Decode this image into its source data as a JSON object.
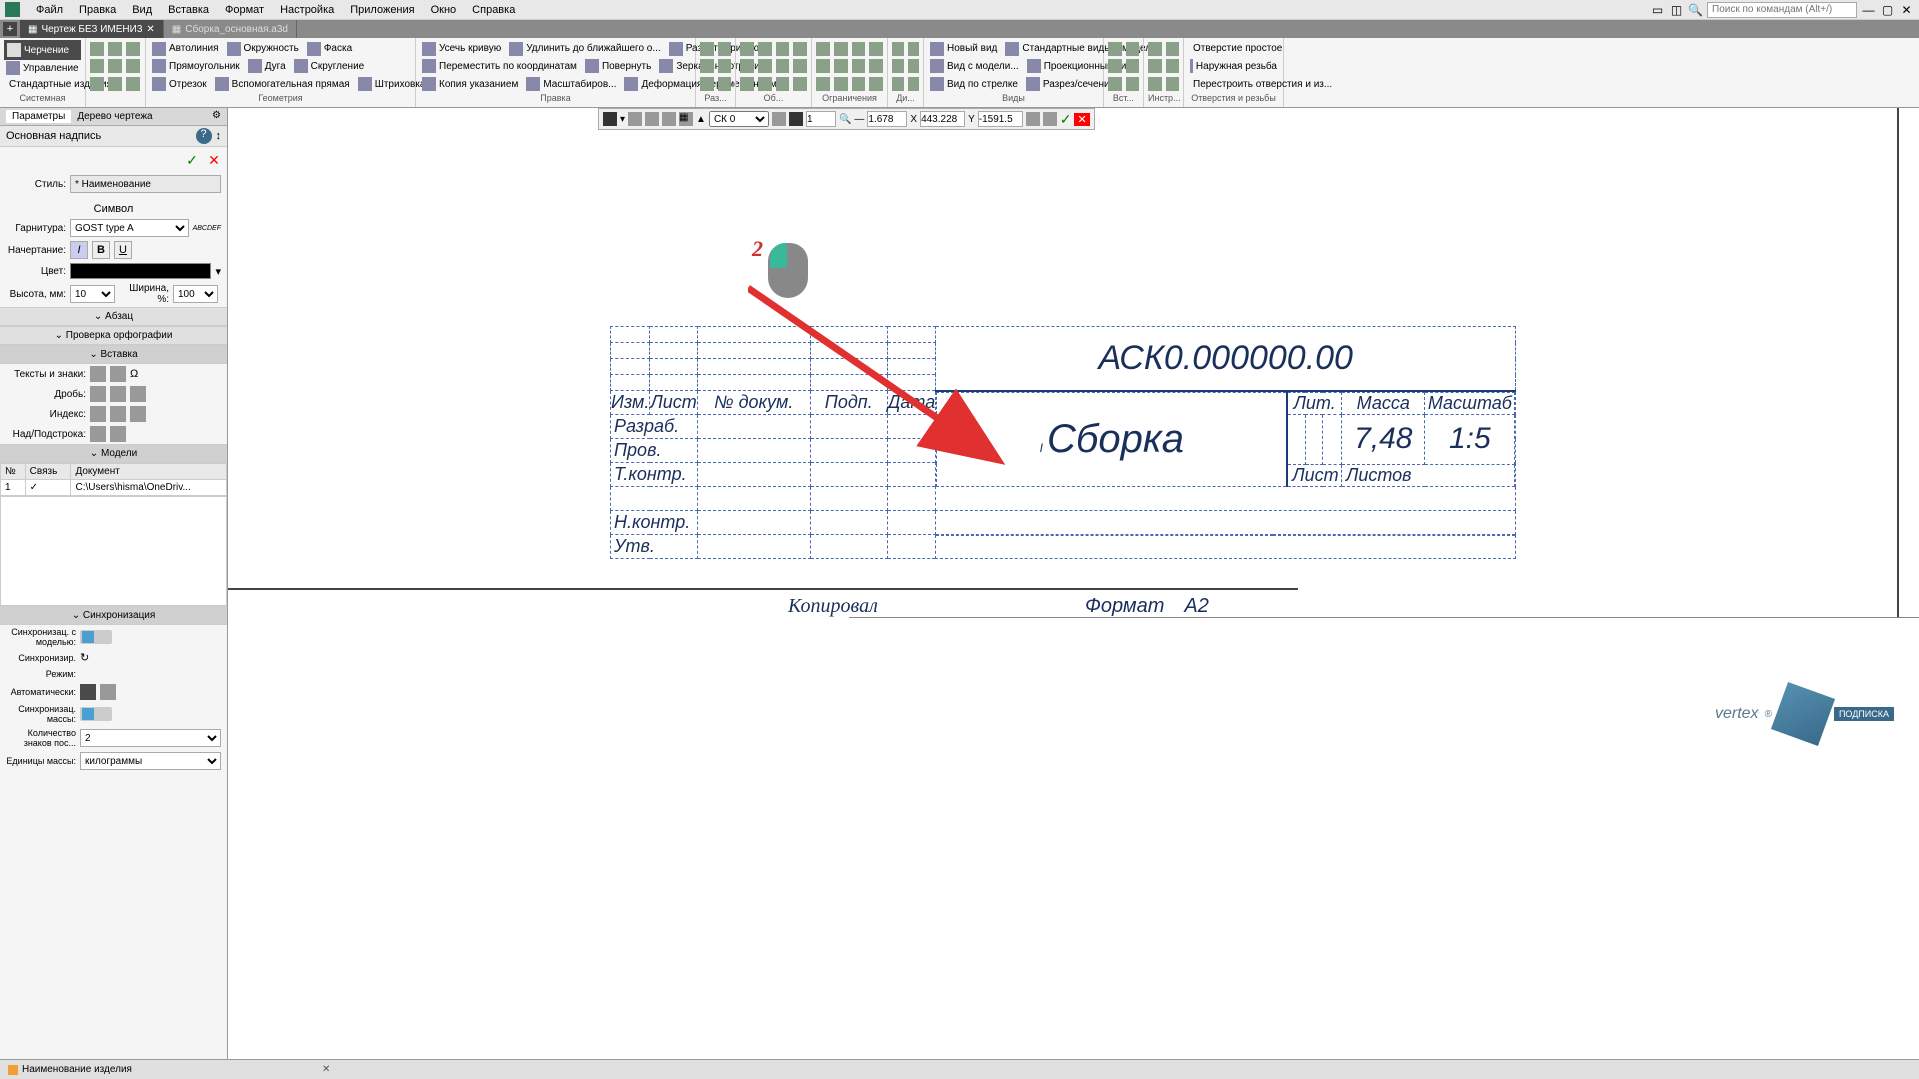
{
  "menu": {
    "items": [
      "Файл",
      "Правка",
      "Вид",
      "Вставка",
      "Формат",
      "Настройка",
      "Приложения",
      "Окно",
      "Справка"
    ],
    "search_placeholder": "Поиск по командам (Alt+/)"
  },
  "tabs": [
    {
      "label": "Чертеж БЕЗ ИМЕНИ3",
      "active": true
    },
    {
      "label": "Сборка_основная.a3d",
      "active": false
    }
  ],
  "ribbon": {
    "groups": [
      {
        "label": "Системная",
        "items": [
          [
            "Черчение"
          ],
          [
            "Управление"
          ],
          [
            "Стандартные изделия"
          ]
        ]
      },
      {
        "label": "",
        "items_icons": 9
      },
      {
        "label": "Геометрия",
        "items": [
          [
            "Автолиния",
            "Окружность",
            "Фаска"
          ],
          [
            "Прямоугольник",
            "Дуга",
            "Скругление"
          ],
          [
            "Отрезок",
            "Вспомогательная прямая",
            "Штриховка"
          ]
        ]
      },
      {
        "label": "Правка",
        "items": [
          [
            "Усечь кривую",
            "Удлинить до ближайшего о...",
            "Разбить кривую"
          ],
          [
            "Переместить по координатам",
            "Повернуть",
            "Зеркально отразить"
          ],
          [
            "Копия указанием",
            "Масштабиров...",
            "Деформация перемещением"
          ]
        ]
      },
      {
        "label": "Раз...",
        "items_icons": 12
      },
      {
        "label": "Об...",
        "items_icons": 12
      },
      {
        "label": "Ограничения",
        "items_icons": 12
      },
      {
        "label": "Ди...",
        "items_icons": 3
      },
      {
        "label": "Виды",
        "items": [
          [
            "Новый вид",
            "Стандартные виды с модел..."
          ],
          [
            "Вид с модели...",
            "Проекционный вид"
          ],
          [
            "Вид по стрелке",
            "Разрез/сечение"
          ]
        ]
      },
      {
        "label": "Вст...",
        "items_icons": 6
      },
      {
        "label": "Инстр...",
        "items_icons": 3
      },
      {
        "label": "Отверстия и резьбы",
        "items": [
          [
            "Отверстие простое"
          ],
          [
            "Наружная резьба"
          ],
          [
            "Перестроить отверстия и из..."
          ]
        ]
      }
    ]
  },
  "canvas_toolbar": {
    "cs": "СК 0",
    "step": "1",
    "zoom": "1.678",
    "x_label": "X",
    "x": "443.228",
    "y_label": "Y",
    "y": "-1591.5"
  },
  "left_panel": {
    "header1": "Параметры",
    "header2": "Дерево чертежа",
    "subheader": "Основная надпись",
    "style_label": "Стиль:",
    "style_value": "* Наименование",
    "symbol_label": "Символ",
    "font_label": "Гарнитура:",
    "font_value": "GOST type A",
    "font_sample": "ABCDEF",
    "weight_label": "Начертание:",
    "color_label": "Цвет:",
    "height_label": "Высота, мм:",
    "height_value": "10",
    "width_label": "Ширина, %:",
    "width_value": "100",
    "sections": {
      "paragraph": "Абзац",
      "spellcheck": "Проверка орфографии",
      "insert": "Вставка",
      "models": "Модели",
      "sync": "Синхронизация"
    },
    "insert_labels": {
      "texts": "Тексты и знаки:",
      "fraction": "Дробь:",
      "index": "Индекс:",
      "overunder": "Над/Подстрока:"
    },
    "models_table": {
      "headers": [
        "№",
        "Связь",
        "Документ"
      ],
      "row": {
        "num": "1",
        "link": "✓",
        "doc": "C:\\Users\\hisma\\OneDriv..."
      }
    },
    "sync": {
      "sync_model": "Синхронизац. с моделью:",
      "sync_arrow": "Синхронизир.",
      "mode": "Режим:",
      "auto": "Автоматически:",
      "sync_mass": "Синхронизац. массы:",
      "digits": "Количество знаков пос...",
      "digits_value": "2",
      "units": "Единицы массы:",
      "units_value": "килограммы"
    }
  },
  "stamp": {
    "doc_number": "АСК0.000000.00",
    "headers": {
      "izm": "Изм.",
      "list": "Лист",
      "ndoc": "№ докум.",
      "podp": "Подп.",
      "data": "Дата",
      "lit": "Лит.",
      "massa": "Масса",
      "mashtab": "Масштаб",
      "list2": "Лист",
      "listov": "Листов"
    },
    "rows": {
      "razrab": "Разраб.",
      "prov": "Пров.",
      "tkontr": "Т.контр.",
      "nkontr": "Н.контр.",
      "utv": "Утв."
    },
    "name": "Сборка",
    "mass_value": "7,48",
    "scale_value": "1:5",
    "bottom": {
      "kopiroval": "Копировал",
      "format": "Формат",
      "format_value": "А2"
    }
  },
  "annotation": {
    "num": "2"
  },
  "statusbar": {
    "text": "Наименование изделия"
  },
  "vertex": {
    "brand": "vertex",
    "badge": "ПОДПИСКА"
  }
}
